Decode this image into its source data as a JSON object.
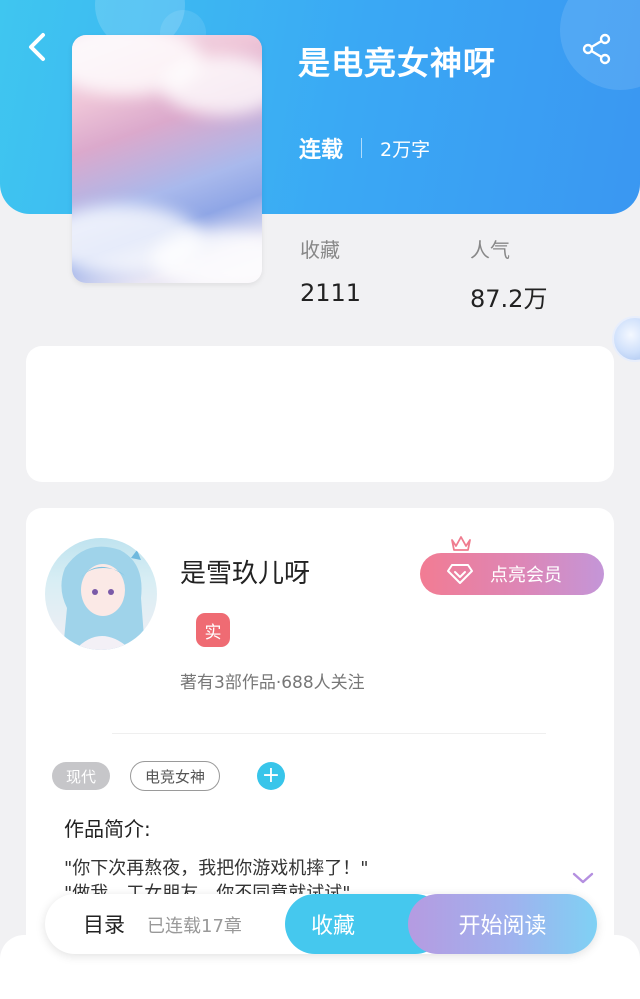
{
  "book": {
    "title": "是电竞女神呀",
    "status": "连载",
    "words": "2万字"
  },
  "stats": {
    "favorites_label": "收藏",
    "favorites_value": "2111",
    "popularity_label": "人气",
    "popularity_value": "87.2万"
  },
  "author": {
    "name": "是雪玖儿呀",
    "real_badge": "实",
    "summary": "著有3部作品·688人关注",
    "vip_button": "点亮会员"
  },
  "tags": [
    "现代",
    "电竞女神"
  ],
  "add_tag_symbol": "+",
  "intro": {
    "heading": "作品简介:",
    "line1": "\"你下次再熬夜，我把你游戏机摔了！\"",
    "line2": "\"做我，工女朋友，你不同意就试试\""
  },
  "bottom_bar": {
    "toc_label": "目录",
    "chapter_count": "已连载17章",
    "favorite_button": "收藏",
    "read_button": "开始阅读"
  },
  "colors": {
    "header_gradient_start": "#3fc6f0",
    "header_gradient_end": "#3a97f2",
    "vip_gradient_start": "#f27c93",
    "vip_gradient_end": "#c496d8",
    "accent_blue": "#45c8ee",
    "badge_red": "#ef6b73"
  },
  "icons": {
    "back": "chevron-left-icon",
    "share": "share-icon",
    "crown": "crown-icon",
    "diamond": "diamond-icon",
    "expand": "chevron-down-icon",
    "add": "plus-icon"
  }
}
